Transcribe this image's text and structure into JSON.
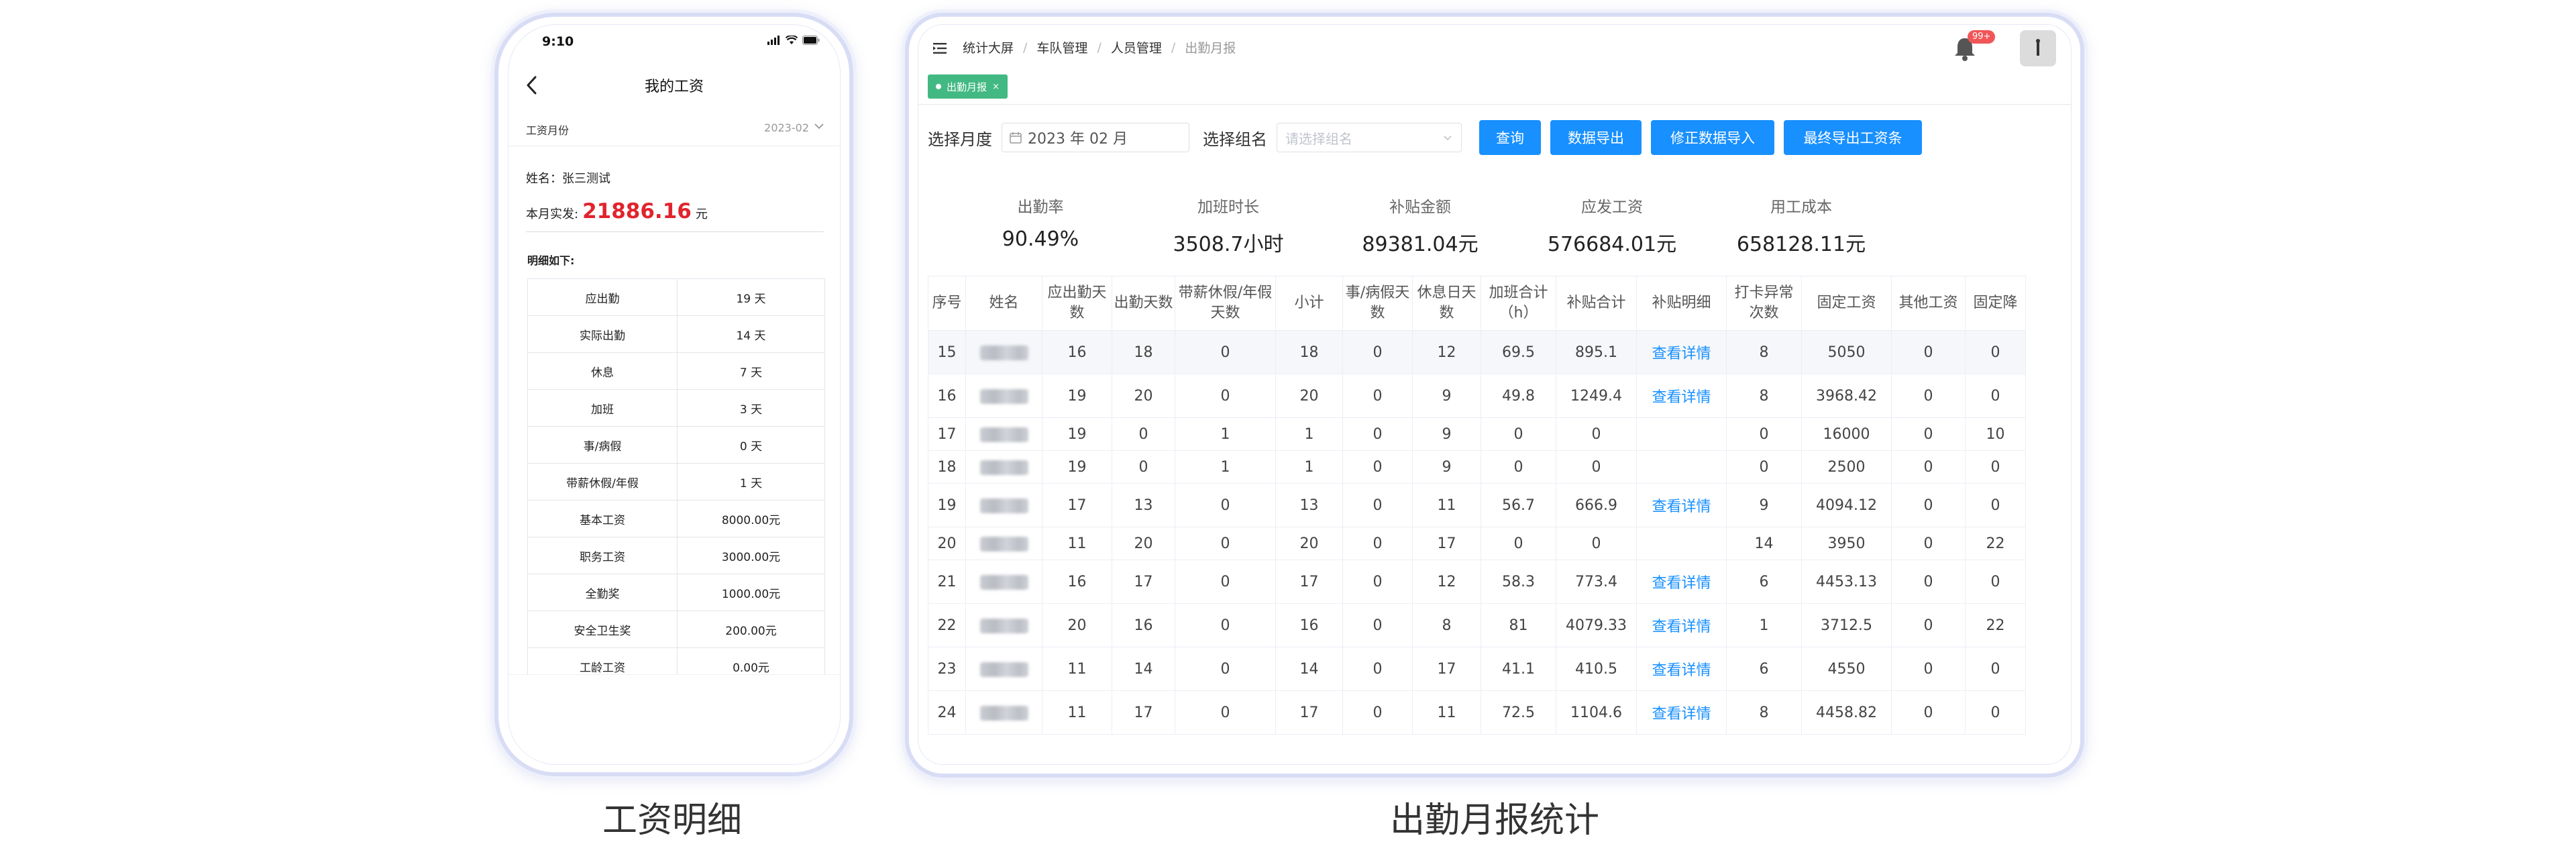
{
  "phone": {
    "status_time": "9:10",
    "title": "我的工资",
    "month_label": "工资月份",
    "month_value": "2023-02",
    "name_label": "姓名：",
    "name_value": "张三测试",
    "pay_label": "本月实发:",
    "pay_amount": "21886.16",
    "pay_unit": "元",
    "detail_label": "明细如下:",
    "rows": [
      {
        "label": "应出勤",
        "value": "19 天"
      },
      {
        "label": "实际出勤",
        "value": "14 天"
      },
      {
        "label": "休息",
        "value": "7 天"
      },
      {
        "label": "加班",
        "value": "3 天"
      },
      {
        "label": "事/病假",
        "value": "0 天"
      },
      {
        "label": "带薪休假/年假",
        "value": "1 天"
      },
      {
        "label": "基本工资",
        "value": "8000.00元"
      },
      {
        "label": "职务工资",
        "value": "3000.00元"
      },
      {
        "label": "全勤奖",
        "value": "1000.00元"
      },
      {
        "label": "安全卫生奖",
        "value": "200.00元"
      },
      {
        "label": "工龄工资",
        "value": "0.00元"
      }
    ]
  },
  "tablet": {
    "breadcrumb": [
      "统计大屏",
      "车队管理",
      "人员管理",
      "出勤月报"
    ],
    "badge": "99+",
    "tag": "出勤月报",
    "tag_close": "×",
    "form": {
      "month_label": "选择月度",
      "month_value": "2023 年 02 月",
      "group_label": "选择组名",
      "group_placeholder": "请选择组名",
      "buttons": [
        "查询",
        "数据导出",
        "修正数据导入",
        "最终导出工资条"
      ]
    },
    "stats": [
      {
        "label": "出勤率",
        "value": "90.49%"
      },
      {
        "label": "加班时长",
        "value": "3508.7小时"
      },
      {
        "label": "补贴金额",
        "value": "89381.04元"
      },
      {
        "label": "应发工资",
        "value": "576684.01元"
      },
      {
        "label": "用工成本",
        "value": "658128.11元"
      }
    ],
    "columns": [
      "序号",
      "姓名",
      "应出勤天数",
      "出勤天数",
      "带薪休假/年假天数",
      "小计",
      "事/病假天数",
      "休息日天数",
      "加班合计（h）",
      "补贴合计",
      "补贴明细",
      "打卡异常次数",
      "固定工资",
      "其他工资",
      "固定降"
    ],
    "link_text": "查看详情",
    "rows": [
      {
        "no": "15",
        "due": "16",
        "att": "18",
        "paid": "0",
        "sub": "18",
        "sick": "0",
        "rest": "12",
        "ot": "69.5",
        "allow": "895.1",
        "detail": true,
        "abn": "8",
        "fixed": "5050",
        "other": "0",
        "cut": "0"
      },
      {
        "no": "16",
        "due": "19",
        "att": "20",
        "paid": "0",
        "sub": "20",
        "sick": "0",
        "rest": "9",
        "ot": "49.8",
        "allow": "1249.4",
        "detail": true,
        "abn": "8",
        "fixed": "3968.42",
        "other": "0",
        "cut": "0"
      },
      {
        "no": "17",
        "due": "19",
        "att": "0",
        "paid": "1",
        "sub": "1",
        "sick": "0",
        "rest": "9",
        "ot": "0",
        "allow": "0",
        "detail": false,
        "abn": "0",
        "fixed": "16000",
        "other": "0",
        "cut": "10"
      },
      {
        "no": "18",
        "due": "19",
        "att": "0",
        "paid": "1",
        "sub": "1",
        "sick": "0",
        "rest": "9",
        "ot": "0",
        "allow": "0",
        "detail": false,
        "abn": "0",
        "fixed": "2500",
        "other": "0",
        "cut": "0"
      },
      {
        "no": "19",
        "due": "17",
        "att": "13",
        "paid": "0",
        "sub": "13",
        "sick": "0",
        "rest": "11",
        "ot": "56.7",
        "allow": "666.9",
        "detail": true,
        "abn": "9",
        "fixed": "4094.12",
        "other": "0",
        "cut": "0"
      },
      {
        "no": "20",
        "due": "11",
        "att": "20",
        "paid": "0",
        "sub": "20",
        "sick": "0",
        "rest": "17",
        "ot": "0",
        "allow": "0",
        "detail": false,
        "abn": "14",
        "fixed": "3950",
        "other": "0",
        "cut": "22"
      },
      {
        "no": "21",
        "due": "16",
        "att": "17",
        "paid": "0",
        "sub": "17",
        "sick": "0",
        "rest": "12",
        "ot": "58.3",
        "allow": "773.4",
        "detail": true,
        "abn": "6",
        "fixed": "4453.13",
        "other": "0",
        "cut": "0"
      },
      {
        "no": "22",
        "due": "20",
        "att": "16",
        "paid": "0",
        "sub": "16",
        "sick": "0",
        "rest": "8",
        "ot": "81",
        "allow": "4079.33",
        "detail": true,
        "abn": "1",
        "fixed": "3712.5",
        "other": "0",
        "cut": "22"
      },
      {
        "no": "23",
        "due": "11",
        "att": "14",
        "paid": "0",
        "sub": "14",
        "sick": "0",
        "rest": "17",
        "ot": "41.1",
        "allow": "410.5",
        "detail": true,
        "abn": "6",
        "fixed": "4550",
        "other": "0",
        "cut": "0"
      },
      {
        "no": "24",
        "due": "11",
        "att": "17",
        "paid": "0",
        "sub": "17",
        "sick": "0",
        "rest": "11",
        "ot": "72.5",
        "allow": "1104.6",
        "detail": true,
        "abn": "8",
        "fixed": "4458.82",
        "other": "0",
        "cut": "0"
      }
    ]
  },
  "captions": {
    "phone": "工资明细",
    "tablet": "出勤月报统计"
  },
  "colors": {
    "primary_button": "#1890ff",
    "tag_green": "#42b983",
    "pay_red": "#e0242d",
    "frame_border": "#d8ddf5",
    "badge_red": "#f05658"
  }
}
